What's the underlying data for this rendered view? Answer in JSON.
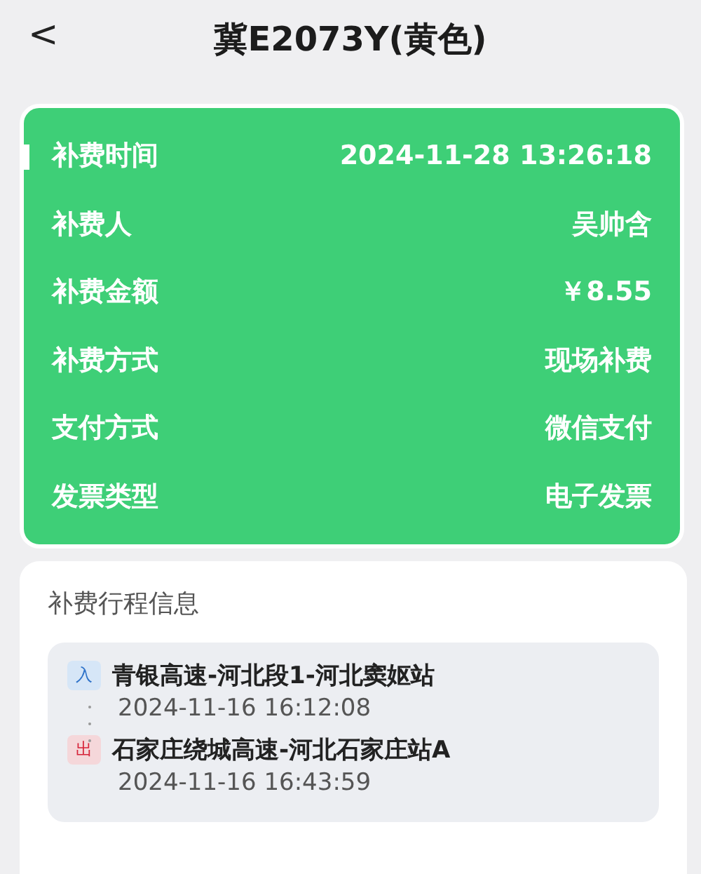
{
  "header": {
    "back": "<",
    "title": "冀E2073Y(黄色)"
  },
  "details": [
    {
      "label": "补费时间",
      "value": "2024-11-28 13:26:18",
      "highlighted": true
    },
    {
      "label": "补费人",
      "value": "吴帅含",
      "highlighted": false
    },
    {
      "label": "补费金额",
      "value": "￥8.55",
      "highlighted": false
    },
    {
      "label": "补费方式",
      "value": "现场补费",
      "highlighted": false
    },
    {
      "label": "支付方式",
      "value": "微信支付",
      "highlighted": false
    },
    {
      "label": "发票类型",
      "value": "电子发票",
      "highlighted": false
    }
  ],
  "trip": {
    "title": "补费行程信息",
    "stops": [
      {
        "kind": "entry",
        "tag": "入",
        "station": "青银高速-河北段1-河北窦妪站",
        "time": "2024-11-16 16:12:08"
      },
      {
        "kind": "exit",
        "tag": "出",
        "station": "石家庄绕城高速-河北石家庄站A",
        "time": "2024-11-16 16:43:59"
      }
    ]
  }
}
